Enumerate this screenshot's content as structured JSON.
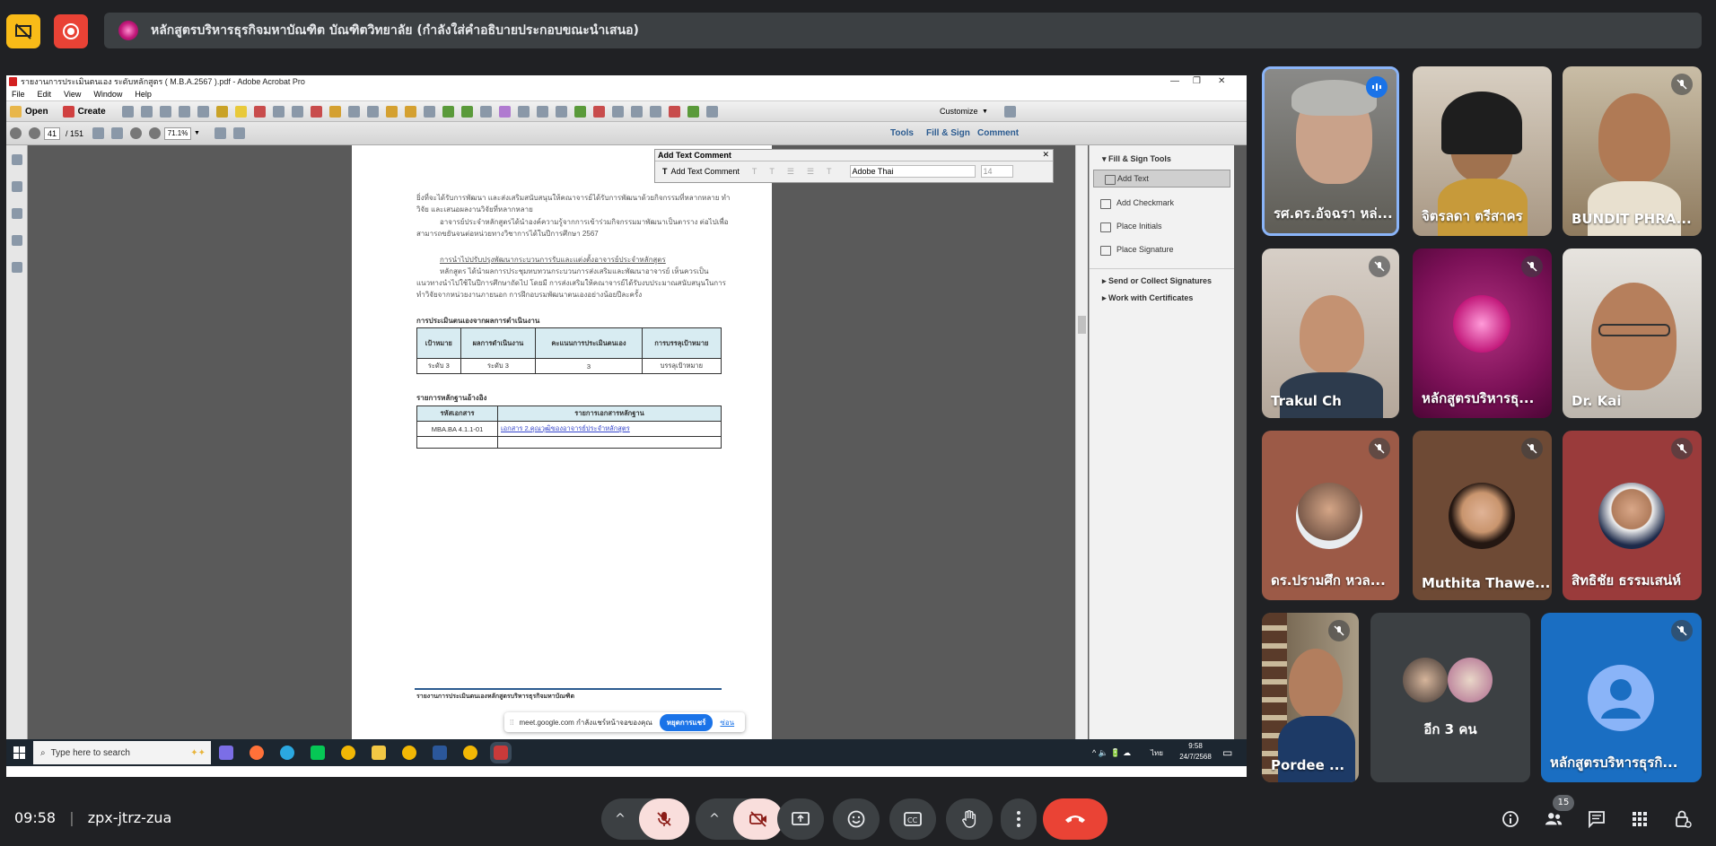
{
  "top": {
    "presentation_title": "หลักสูตรบริหารธุรกิจมหาบัณฑิต บัณฑิตวิทยาลัย (กำลังใส่คำอธิบายประกอบขณะนำเสนอ)"
  },
  "acrobat": {
    "window_title": "รายงานการประเมินตนเอง ระดับหลักสูตร ( M.B.A.2567 ).pdf - Adobe Acrobat Pro",
    "menu": [
      "File",
      "Edit",
      "View",
      "Window",
      "Help"
    ],
    "open_label": "Open",
    "create_label": "Create",
    "customize_label": "Customize",
    "page_current": "41",
    "page_total": "/ 151",
    "zoom": "71.1%",
    "tabs": [
      "Tools",
      "Fill & Sign",
      "Comment"
    ],
    "text_comment": {
      "title": "Add Text Comment",
      "button": "Add Text Comment",
      "font": "Adobe Thai",
      "size": "14"
    },
    "panel": {
      "section": "Fill & Sign Tools",
      "items": [
        "Add Text",
        "Add Checkmark",
        "Place Initials",
        "Place Signature"
      ],
      "send": "Send or Collect Signatures",
      "certs": "Work with Certificates"
    },
    "doc": {
      "para1": "ยิ่งที่จะได้รับการพัฒนา และส่งเสริมสนับสนุนให้คณาจารย์ได้รับการพัฒนาด้วยกิจกรรมที่หลากหลาย ทำวิจัย และเสนอผลงานวิจัยที่หลากหลาย",
      "para2": "อาจารย์ประจำหลักสูตรได้นำองค์ความรู้จากการเข้าร่วมกิจกรรมมาพัฒนาเป็นตาราง ต่อไปเพื่อสามารถขยันจนต่อหน่วยทางวิชาการได้ในปีการศึกษา 2567",
      "heading1": "การนำไปปรับปรุงพัฒนากระบวนการรับและแต่งตั้งอาจารย์ประจำหลักสูตร",
      "para3": "หลักสูตร ได้นำผลการประชุมทบทวนกระบวนการส่งเสริมและพัฒนาอาจารย์ เห็นควรเป็นแนวทางนำไปใช้ในปีการศึกษาถัดไป โดยมี การส่งเสริมให้คณาจารย์ได้รับงบประมาณสนับสนุนในการทำวิจัยจากหน่วยงานภายนอก การฝึกอบรมพัฒนาตนเองอย่างน้อยปีละครั้ง",
      "heading2": "การประเมินตนเองจากผลการดำเนินงาน",
      "eval_headers": [
        "เป้าหมาย",
        "ผลการดำเนินงาน",
        "คะแนนการประเมินตนเอง",
        "การบรรลุเป้าหมาย"
      ],
      "eval_row": [
        "ระดับ 3",
        "ระดับ 3",
        "3",
        "บรรลุเป้าหมาย"
      ],
      "heading3": "รายการหลักฐานอ้างอิง",
      "ev_headers": [
        "รหัสเอกสาร",
        "รายการเอกสารหลักฐาน"
      ],
      "ev_row": [
        "MBA.BA 4.1.1-01",
        "เอกสาร 2.คุณวุฒิของอาจารย์ประจำหลักสูตร"
      ],
      "footer": "รายงานการประเมินตนเองหลักสูตรบริหารธุรกิจมหาบัณฑิต"
    },
    "share_chip": {
      "text": "meet.google.com กำลังแชร์หน้าจอของคุณ",
      "stop": "หยุดการแชร์",
      "hide": "ซ่อน"
    },
    "taskbar": {
      "search": "Type here to search",
      "time": "9:58",
      "date": "24/7/2568",
      "lang": "ไทย"
    }
  },
  "participants": [
    {
      "name": "รศ.ดร.อัจฉรา หล่...",
      "speaking": true
    },
    {
      "name": "จิตรลดา ตรีสาคร",
      "muted": false
    },
    {
      "name": "BUNDIT PHRA...",
      "muted": true
    },
    {
      "name": "Trakul Ch",
      "muted": true
    },
    {
      "name": "หลักสูตรบริหารธุ...",
      "muted": true
    },
    {
      "name": "Dr. Kai",
      "muted": false
    },
    {
      "name": "ดร.ปรามศึก หวล...",
      "muted": true
    },
    {
      "name": "Muthita Thawe...",
      "muted": true
    },
    {
      "name": "สิทธิชัย ธรรมเสน่ห์",
      "muted": true
    },
    {
      "name": "Pordee ...",
      "muted": true
    },
    {
      "name": "อีก 3 คน"
    },
    {
      "name": "หลักสูตรบริหารธุรกิ...",
      "muted": true
    }
  ],
  "meeting": {
    "time": "09:58",
    "code": "zpx-jtrz-zua",
    "people_count": "15"
  }
}
